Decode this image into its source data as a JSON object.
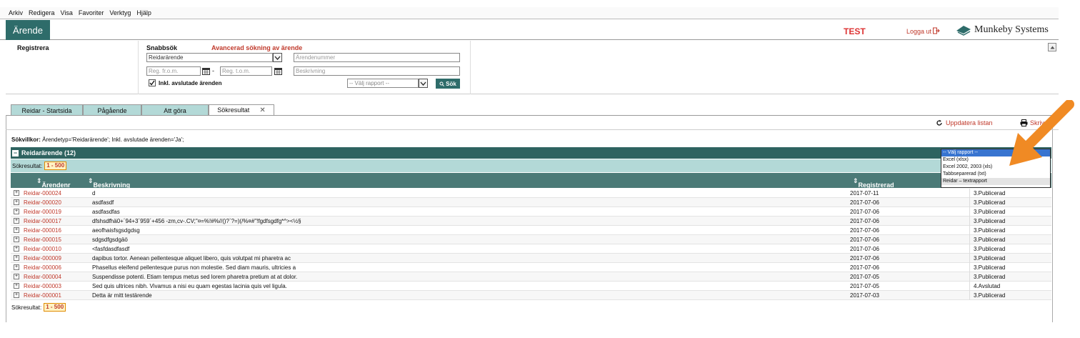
{
  "menu": [
    "Arkiv",
    "Redigera",
    "Visa",
    "Favoriter",
    "Verktyg",
    "Hjälp"
  ],
  "header": {
    "module_tab": "Ärende",
    "env_label": "TEST",
    "logout_label": "Logga ut",
    "brand": "Munkeby Systems"
  },
  "search": {
    "registrera_label": "Registrera",
    "snabbsok_label": "Snabbsök",
    "advanced_label": "Avancerad sökning av ärende",
    "type_value": "Reidarärende",
    "arendenummer_placeholder": "Ärendenummer",
    "reg_from_placeholder": "Reg. fr.o.m.",
    "reg_to_placeholder": "Reg. t.o.m.",
    "date_separator": "-",
    "beskrivning_placeholder": "Beskrivning",
    "include_closed_label": "Inkl. avslutade ärenden",
    "include_closed_checked": true,
    "report_select_value": "-- Välj rapport --",
    "search_button": "Sök"
  },
  "tabs": [
    {
      "label": "Reidar - Startsida",
      "active": false
    },
    {
      "label": "Pågående",
      "active": false
    },
    {
      "label": "Att göra",
      "active": false
    },
    {
      "label": "Sökresultat",
      "active": true,
      "closable": true
    }
  ],
  "toolbar": {
    "update_label": "Uppdatera listan",
    "print_label": "Skriv"
  },
  "criteria": {
    "label": "Sökvillkor:",
    "text": "Ärendetyp='Reidarärende'; Inkl. avslutade ärenden='Ja';"
  },
  "group": {
    "title": "Reidarärende (12)",
    "result_label": "Sökresultat:",
    "pager": "1 - 500"
  },
  "columns": {
    "arendenr": "Ärendenr",
    "beskrivning": "Beskrivning",
    "registrerad": "Registrerad datum",
    "status": ""
  },
  "rows": [
    {
      "nr": "Reidar-000024",
      "desc": "d",
      "date": "2017-07-11",
      "status": "3.Publicerad"
    },
    {
      "nr": "Reidar-000020",
      "desc": "asdfasdf",
      "date": "2017-07-06",
      "status": "3.Publicerad"
    },
    {
      "nr": "Reidar-000019",
      "desc": "asdfasdfas",
      "date": "2017-07-06",
      "status": "3.Publicerad"
    },
    {
      "nr": "Reidar-000017",
      "desc": "dfshsdfhä0+´94+3´959´+456 -zm,cv-.CV;\"¤=%!#%//()?`?=)(/%¤#\"!fgdfsgdfg*^><½§",
      "date": "2017-07-06",
      "status": "3.Publicerad"
    },
    {
      "nr": "Reidar-000016",
      "desc": "aeofhaisfsgsdgdsg",
      "date": "2017-07-06",
      "status": "3.Publicerad"
    },
    {
      "nr": "Reidar-000015",
      "desc": "sdgsdfgsdgäö",
      "date": "2017-07-06",
      "status": "3.Publicerad"
    },
    {
      "nr": "Reidar-000010",
      "desc": "<fasfdasdfasdf",
      "date": "2017-07-06",
      "status": "3.Publicerad"
    },
    {
      "nr": "Reidar-000009",
      "desc": "dapibus tortor. Aenean pellentesque aliquet libero, quis volutpat mi pharetra ac",
      "date": "2017-07-06",
      "status": "3.Publicerad"
    },
    {
      "nr": "Reidar-000006",
      "desc": "Phasellus eleifend pellentesque purus non molestie. Sed diam mauris, ultricies a",
      "date": "2017-07-06",
      "status": "3.Publicerad"
    },
    {
      "nr": "Reidar-000004",
      "desc": "Suspendisse potenti. Etiam tempus metus sed lorem pharetra pretium at at dolor.",
      "date": "2017-07-05",
      "status": "3.Publicerad"
    },
    {
      "nr": "Reidar-000003",
      "desc": "Sed quis ultrices nibh. Vivamus a nisi eu quam egestas lacinia quis vel ligula.",
      "date": "2017-07-05",
      "status": "4.Avslutad"
    },
    {
      "nr": "Reidar-000001",
      "desc": "Detta är mitt testärende",
      "date": "2017-07-03",
      "status": "3.Publicerad"
    }
  ],
  "report_dropdown": {
    "options": [
      "-- Välj rapport --",
      "Excel (xlsx)",
      "Excel 2002, 2003 (xls)",
      "Tabbseparerad (txt)",
      "Reidar – textrapport"
    ],
    "selected_index": 0
  },
  "colors": {
    "teal_dark": "#2e6c6a",
    "teal_light": "#b3d9d7",
    "link_red": "#c0392b",
    "arrow_orange": "#f08a24"
  }
}
